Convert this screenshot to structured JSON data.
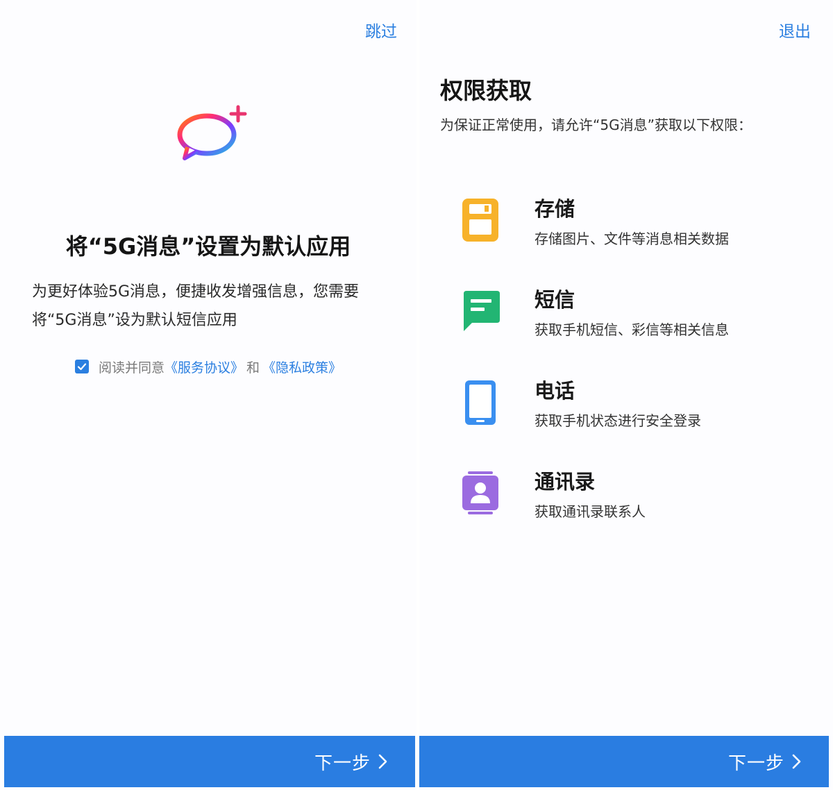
{
  "welcome": {
    "skip_label": "跳过",
    "title": "将“5G消息”设置为默认应用",
    "description_line1": "为更好体验5G消息，便捷收发增强信息，您需要",
    "description_line2": "将“5G消息”设为默认短信应用",
    "agreement": {
      "checked": true,
      "prefix": "阅读并同意",
      "service_link": "《服务协议》",
      "and": "和",
      "privacy_link": "《隐私政策》"
    },
    "next_label": "下一步"
  },
  "permissions": {
    "exit_label": "退出",
    "title": "权限获取",
    "description": "为保证正常使用，请允许“5G消息”获取以下权限：",
    "items": [
      {
        "name": "存储",
        "desc": "存储图片、文件等消息相关数据",
        "icon": "storage-icon",
        "color": "#f7b22a"
      },
      {
        "name": "短信",
        "desc": "获取手机短信、彩信等相关信息",
        "icon": "sms-icon",
        "color": "#22b573"
      },
      {
        "name": "电话",
        "desc": "获取手机状态进行安全登录",
        "icon": "phone-icon",
        "color": "#3a8ff0"
      },
      {
        "name": "通讯录",
        "desc": "获取通讯录联系人",
        "icon": "contacts-icon",
        "color": "#9b6be0"
      }
    ],
    "next_label": "下一步"
  },
  "colors": {
    "accent": "#2a7de1",
    "link": "#2b7fe0"
  }
}
